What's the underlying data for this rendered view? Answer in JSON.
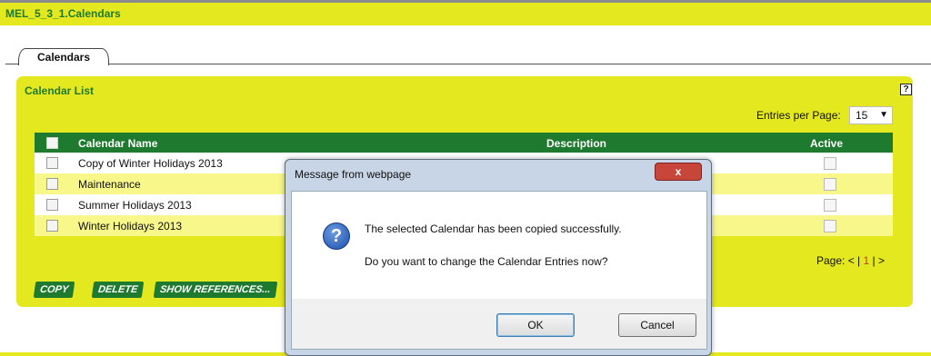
{
  "page_title": "MEL_5_3_1.Calendars",
  "tab": "Calendars",
  "panel": {
    "title": "Calendar List",
    "help": "?",
    "entries_label": "Entries per Page:",
    "entries_value": "15",
    "columns": {
      "name": "Calendar Name",
      "description": "Description",
      "active": "Active"
    },
    "rows": [
      {
        "name": "Copy of Winter Holidays 2013"
      },
      {
        "name": "Maintenance"
      },
      {
        "name": "Summer Holidays 2013"
      },
      {
        "name": "Winter Holidays 2013"
      }
    ],
    "pager": {
      "prefix": "Page: <",
      "sep1": "|",
      "current": "1",
      "sep2": "|",
      "next": ">"
    },
    "buttons": {
      "copy": "COPY",
      "delete": "DELETE",
      "show_references": "SHOW REFERENCES..."
    }
  },
  "dialog": {
    "title": "Message from webpage",
    "close": "x",
    "message1": "The selected Calendar has been copied successfully.",
    "message2": "Do you want to change the Calendar Entries now?",
    "ok": "OK",
    "cancel": "Cancel"
  },
  "colors": {
    "accent": "#e4e81e",
    "header_green": "#1e7a2e",
    "row_alt": "#f7f78a"
  }
}
